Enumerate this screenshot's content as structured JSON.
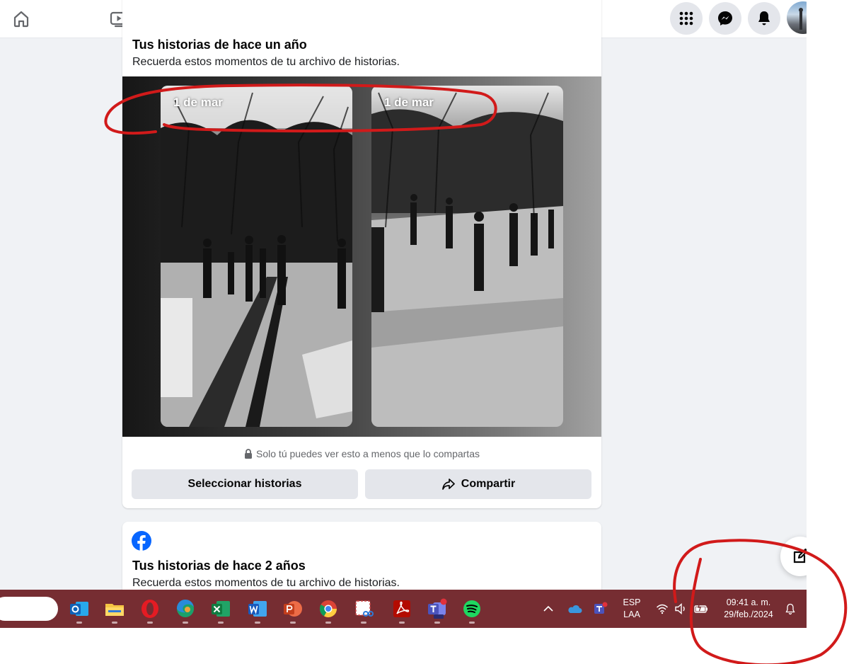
{
  "nav": {
    "tabs": [
      {
        "name": "home-icon"
      },
      {
        "name": "video-icon"
      },
      {
        "name": "marketplace-icon"
      },
      {
        "name": "groups-icon"
      },
      {
        "name": "gaming-icon"
      }
    ],
    "right_buttons": [
      {
        "name": "menu-grid-icon"
      },
      {
        "name": "messenger-icon"
      },
      {
        "name": "bell-icon"
      }
    ]
  },
  "memories_card_1": {
    "title": "Tus historias de hace un año",
    "subtitle": "Recuerda estos momentos de tu archivo de historias.",
    "stories": [
      {
        "date": "1 de mar"
      },
      {
        "date": "1 de mar"
      }
    ],
    "privacy_note": "Solo tú puedes ver esto a menos que lo compartas",
    "select_button": "Seleccionar historias",
    "share_button": "Compartir"
  },
  "memories_card_2": {
    "title": "Tus historias de hace 2 años",
    "subtitle": "Recuerda estos momentos de tu archivo de historias."
  },
  "taskbar": {
    "apps": [
      "outlook-icon",
      "file-explorer-icon",
      "opera-icon",
      "edge-icon",
      "excel-icon",
      "word-icon",
      "powerpoint-icon",
      "chrome-icon",
      "snipping-tool-icon",
      "acrobat-icon",
      "teams-new-icon",
      "spotify-icon"
    ],
    "language": {
      "line1": "ESP",
      "line2": "LAA"
    },
    "clock": {
      "time": "09:41 a. m.",
      "date": "29/feb./2024"
    }
  },
  "colors": {
    "facebook_blue": "#0866ff",
    "taskbar": "#762d32",
    "annotation_red": "#d11a1a"
  }
}
